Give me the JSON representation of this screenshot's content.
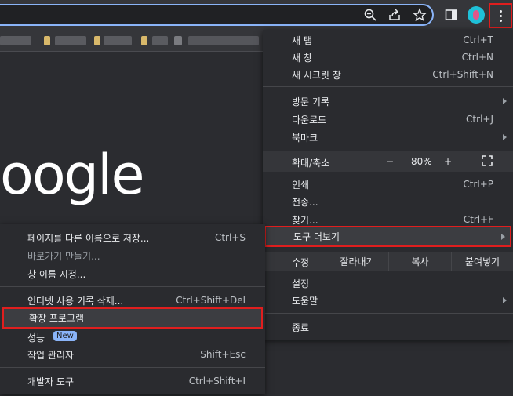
{
  "main_menu": {
    "items": [
      {
        "label": "새 탭",
        "shortcut": "Ctrl+T"
      },
      {
        "label": "새 창",
        "shortcut": "Ctrl+N"
      },
      {
        "label": "새 시크릿 창",
        "shortcut": "Ctrl+Shift+N"
      },
      {
        "label": "방문 기록",
        "shortcut": ""
      },
      {
        "label": "다운로드",
        "shortcut": "Ctrl+J"
      },
      {
        "label": "북마크",
        "shortcut": ""
      }
    ],
    "zoom": {
      "label": "확대/축소",
      "minus": "−",
      "value": "80%",
      "plus": "+"
    },
    "items2": [
      {
        "label": "인쇄",
        "shortcut": "Ctrl+P"
      },
      {
        "label": "전송...",
        "shortcut": ""
      },
      {
        "label": "찾기...",
        "shortcut": "Ctrl+F"
      },
      {
        "label": "도구 더보기",
        "shortcut": ""
      }
    ],
    "edit": {
      "label": "수정",
      "cut": "잘라내기",
      "copy": "복사",
      "paste": "붙여넣기"
    },
    "items3": [
      {
        "label": "설정"
      },
      {
        "label": "도움말"
      },
      {
        "label": "종료"
      }
    ]
  },
  "sub_menu": {
    "items": [
      {
        "label": "페이지를 다른 이름으로 저장...",
        "shortcut": "Ctrl+S"
      },
      {
        "label": "바로가기 만들기...",
        "shortcut": ""
      },
      {
        "label": "창 이름 지정...",
        "shortcut": ""
      },
      {
        "label": "인터넷 사용 기록 삭제...",
        "shortcut": "Ctrl+Shift+Del"
      },
      {
        "label": "확장 프로그램",
        "shortcut": ""
      },
      {
        "label": "성능",
        "badge": "New"
      },
      {
        "label": "작업 관리자",
        "shortcut": "Shift+Esc"
      },
      {
        "label": "개발자 도구",
        "shortcut": "Ctrl+Shift+I"
      }
    ]
  },
  "page": {
    "logo_text": "oogle"
  },
  "icons": [
    "zoom-icon",
    "share-icon",
    "star-icon",
    "side-panel-icon",
    "profile-avatar",
    "kebab-menu-icon"
  ],
  "colors": {
    "highlight_border": "#e01e1e",
    "badge": "#8ab4f8",
    "accent": "#8ab4f8"
  }
}
